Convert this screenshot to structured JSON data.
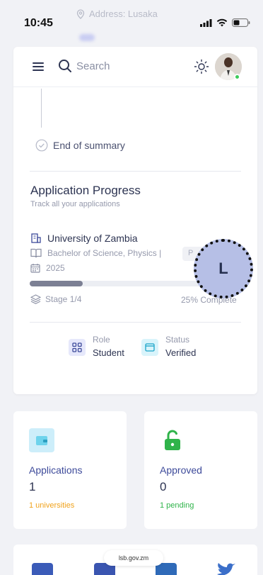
{
  "statusbar": {
    "time": "10:45",
    "address": "Address: Lusaka"
  },
  "topbar": {
    "search_label": "Search"
  },
  "summary": {
    "end_label": "End of summary"
  },
  "application_progress": {
    "title": "Application Progress",
    "subtitle": "Track all your applications",
    "university": "University of Zambia",
    "program": "Bachelor of Science, Physics |",
    "year": "2025",
    "pill_text": "P",
    "progress_fraction": 0.25,
    "stage": "Stage 1/4",
    "complete": "25% Complete",
    "role_label": "Role",
    "role_value": "Student",
    "status_label": "Status",
    "status_value": "Verified"
  },
  "overlay_badge": "L",
  "stats": {
    "applications": {
      "title": "Applications",
      "count": "1",
      "sub": "1 universities"
    },
    "approved": {
      "title": "Approved",
      "count": "0",
      "sub": "1 pending"
    }
  },
  "footer": {
    "url": "lsb.gov.zm"
  },
  "colors": {
    "accent": "#3d4a9a",
    "orange": "#f0a21b",
    "green": "#2fb34a",
    "cyan": "#6ed3ec"
  }
}
